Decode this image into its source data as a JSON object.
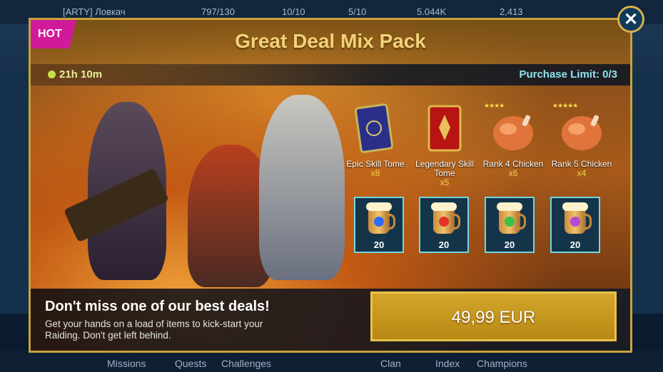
{
  "background": {
    "topbar": [
      "[ARTY] Ловкач",
      "797/130",
      "10/10",
      "5/10",
      "5.044K",
      "2,413"
    ],
    "bottom_nav": [
      "Missions",
      "Quests",
      "Challenges",
      "Clan",
      "Index",
      "Champions"
    ]
  },
  "offer": {
    "badge": "HOT",
    "title": "Great Deal Mix Pack",
    "timer": "21h 10m",
    "purchase_limit": "Purchase Limit: 0/3",
    "items": [
      {
        "label": "Epic Skill Tome",
        "qty": "x8",
        "icon": "epic-skill-tome-icon"
      },
      {
        "label": "Legendary Skill Tome",
        "qty": "x5",
        "icon": "legendary-skill-tome-icon"
      },
      {
        "label": "Rank 4 Chicken",
        "qty": "x6",
        "icon": "rank-4-chicken-icon",
        "stars": "★★★★"
      },
      {
        "label": "Rank 5 Chicken",
        "qty": "x4",
        "icon": "rank-5-chicken-icon",
        "stars": "★★★★★"
      }
    ],
    "potions": [
      {
        "count": "20",
        "icon": "blue-potion-mug-icon",
        "color": "#2f6bff"
      },
      {
        "count": "20",
        "icon": "red-potion-mug-icon",
        "color": "#e6332a"
      },
      {
        "count": "20",
        "icon": "green-potion-mug-icon",
        "color": "#39c24a"
      },
      {
        "count": "20",
        "icon": "purple-potion-mug-icon",
        "color": "#b54ad9"
      }
    ],
    "headline": "Don't miss one of our best deals!",
    "description": "Get your hands on a load of items to kick-start your Raiding. Don't get left behind.",
    "price": "49,99 EUR"
  },
  "colors": {
    "accent_gold": "#c8a23c",
    "hot_badge": "#d11a9a",
    "limit_text": "#8fe3ef"
  }
}
